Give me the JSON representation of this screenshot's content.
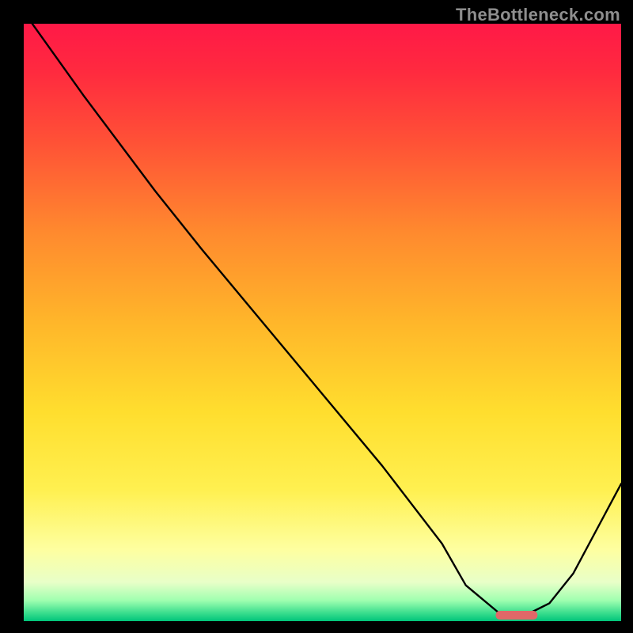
{
  "watermark": "TheBottleneck.com",
  "chart_data": {
    "type": "line",
    "title": "",
    "xlabel": "",
    "ylabel": "",
    "xlim": [
      0,
      100
    ],
    "ylim": [
      0,
      100
    ],
    "grid": false,
    "series": [
      {
        "name": "bottleneck-curve",
        "x": [
          0,
          10,
          22,
          30,
          40,
          50,
          60,
          70,
          74,
          80,
          84,
          88,
          92,
          100
        ],
        "values": [
          102,
          88,
          72,
          62,
          50,
          38,
          26,
          13,
          6,
          1,
          1,
          3,
          8,
          23
        ]
      }
    ],
    "marker_segment": {
      "x0": 79,
      "x1": 86,
      "y": 1.0
    },
    "gradient_stops": [
      {
        "offset": 0.0,
        "color": "#ff1947"
      },
      {
        "offset": 0.08,
        "color": "#ff2a3f"
      },
      {
        "offset": 0.2,
        "color": "#ff5236"
      },
      {
        "offset": 0.35,
        "color": "#ff8a2e"
      },
      {
        "offset": 0.5,
        "color": "#ffb62a"
      },
      {
        "offset": 0.65,
        "color": "#ffde2e"
      },
      {
        "offset": 0.78,
        "color": "#fff050"
      },
      {
        "offset": 0.88,
        "color": "#feffa0"
      },
      {
        "offset": 0.935,
        "color": "#e8ffc8"
      },
      {
        "offset": 0.965,
        "color": "#a0ffb0"
      },
      {
        "offset": 0.985,
        "color": "#40e090"
      },
      {
        "offset": 1.0,
        "color": "#00c47a"
      }
    ]
  }
}
